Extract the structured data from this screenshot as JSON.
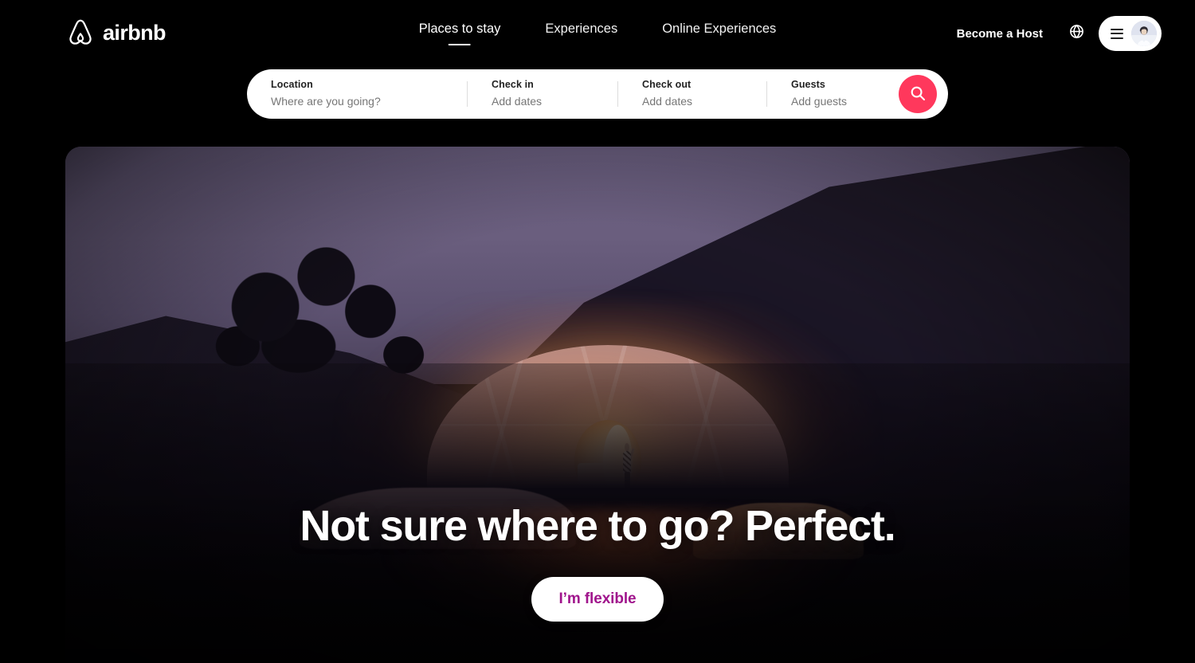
{
  "brand": {
    "name": "airbnb",
    "logo_icon": "airbnb-belo-icon",
    "accent_color": "#FF385C",
    "flexible_text_color": "#A0148C"
  },
  "header": {
    "nav": [
      {
        "label": "Places to stay",
        "active": true
      },
      {
        "label": "Experiences",
        "active": false
      },
      {
        "label": "Online Experiences",
        "active": false
      }
    ],
    "become_host_label": "Become a Host",
    "globe_icon": "globe-icon",
    "menu_icon": "hamburger-menu-icon",
    "avatar_icon": "user-avatar"
  },
  "search": {
    "fields": [
      {
        "label": "Location",
        "value": "Where are you going?",
        "placeholder": "Where are you going?"
      },
      {
        "label": "Check in",
        "value": "Add dates",
        "placeholder": "Add dates"
      },
      {
        "label": "Check out",
        "value": "Add dates",
        "placeholder": "Add dates"
      },
      {
        "label": "Guests",
        "value": "Add guests",
        "placeholder": "Add guests"
      }
    ],
    "search_icon": "search-icon"
  },
  "hero": {
    "title": "Not sure where to go? Perfect.",
    "cta_label": "I’m flexible",
    "image_alt": "Illuminated geodesic dome glamping tent at dusk with a person waving in the circular doorway, purple twilight sky and silhouetted hillside"
  }
}
